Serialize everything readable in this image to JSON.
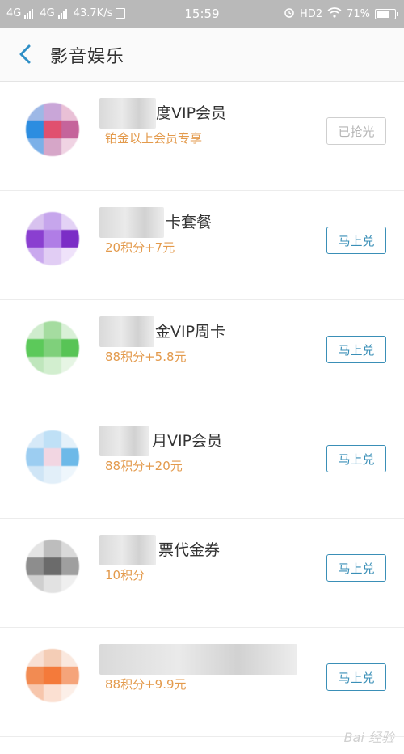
{
  "status_bar": {
    "network1": "4G",
    "network2": "4G",
    "speed": "43.7K/s",
    "time": "15:59",
    "hd": "HD2",
    "battery": "71%"
  },
  "header": {
    "title": "影音娱乐"
  },
  "items": [
    {
      "name": "度VIP会员",
      "price": "铂金以上会员专享",
      "button": "已抢光",
      "button_disabled": true
    },
    {
      "name": "卡套餐",
      "price": "20积分+7元",
      "button": "马上兑",
      "button_disabled": false
    },
    {
      "name": "金VIP周卡",
      "price": "88积分+5.8元",
      "button": "马上兑",
      "button_disabled": false
    },
    {
      "name": "月VIP会员",
      "price": "88积分+20元",
      "button": "马上兑",
      "button_disabled": false
    },
    {
      "name": "票代金券",
      "price": "10积分",
      "button": "马上兑",
      "button_disabled": false
    },
    {
      "name": "",
      "price": "88积分+9.9元",
      "button": "马上兑",
      "button_disabled": false
    }
  ],
  "watermark": "Bai 经验",
  "colors": {
    "accent": "#3a8fb7",
    "price": "#e39a4c",
    "status_bar": "#b9b9b9"
  }
}
